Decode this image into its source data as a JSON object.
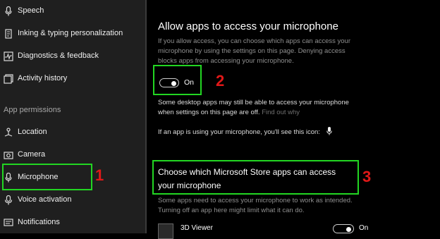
{
  "sidebar": {
    "items_top": [
      {
        "label": "Speech",
        "icon": "microphone-speech-icon"
      },
      {
        "label": "Inking & typing personalization",
        "icon": "pen-icon"
      },
      {
        "label": "Diagnostics & feedback",
        "icon": "diagnostics-icon"
      },
      {
        "label": "Activity history",
        "icon": "history-icon"
      }
    ],
    "section_header": "App permissions",
    "items_permissions": [
      {
        "label": "Location",
        "icon": "location-icon"
      },
      {
        "label": "Camera",
        "icon": "camera-icon"
      },
      {
        "label": "Microphone",
        "icon": "microphone-icon"
      },
      {
        "label": "Voice activation",
        "icon": "voice-activation-icon"
      },
      {
        "label": "Notifications",
        "icon": "notifications-icon"
      }
    ]
  },
  "main": {
    "heading": "Allow apps to access your microphone",
    "description": "If you allow access, you can choose which apps can access your microphone by using the settings on this page. Denying access blocks apps from accessing your microphone.",
    "toggle_state": "On",
    "desktop_note": "Some desktop apps may still be able to access your microphone when settings on this page are off.",
    "find_out_link": "Find out why",
    "icon_note": "If an app is using your microphone, you'll see this icon:",
    "store_heading_line1": "Choose which Microsoft Store apps can access",
    "store_heading_line2": "your microphone",
    "store_note": "Some apps need to access your microphone to work as intended. Turning off an app here might limit what it can do.",
    "apps": [
      {
        "name": "3D Viewer",
        "state": "On"
      }
    ]
  },
  "annotations": {
    "n1": "1",
    "n2": "2",
    "n3": "3"
  },
  "colors": {
    "sidebar_bg": "#1f1f1f",
    "main_bg": "#000000",
    "annotation_box": "#22d622",
    "annotation_number": "#e01818"
  }
}
